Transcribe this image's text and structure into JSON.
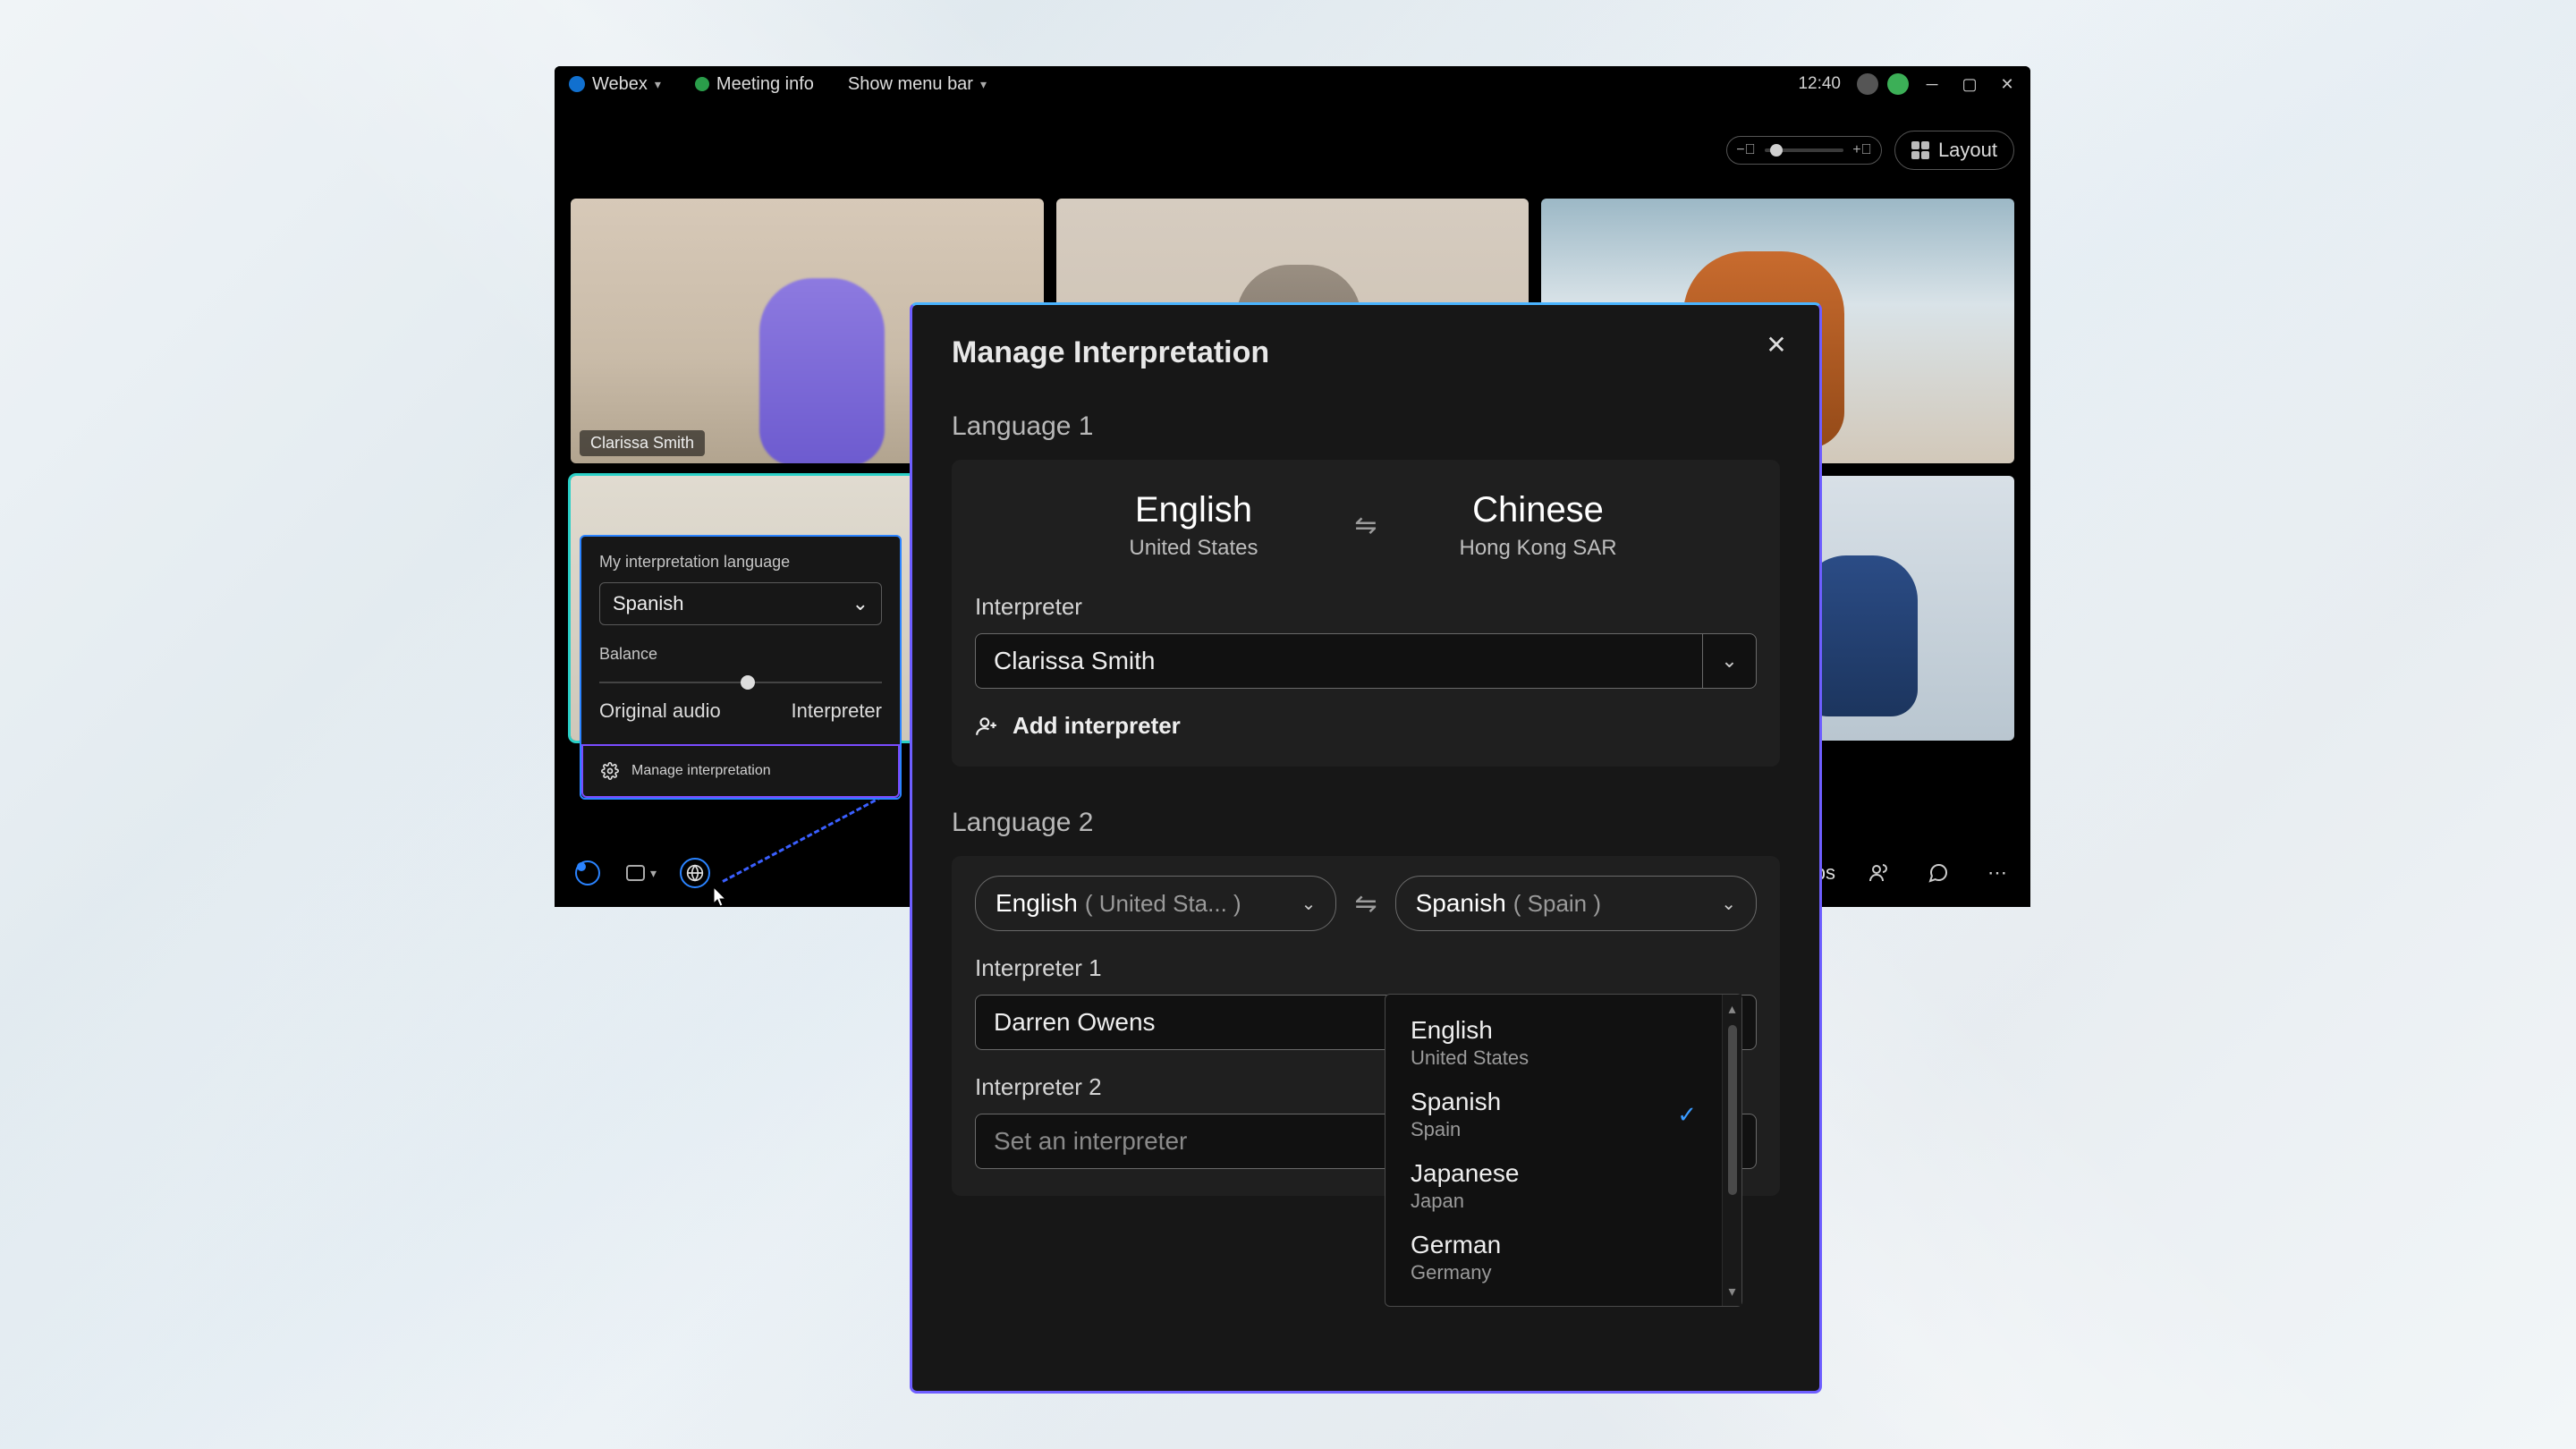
{
  "titlebar": {
    "appName": "Webex",
    "meetingInfo": "Meeting info",
    "showMenu": "Show menu bar",
    "clock": "12:40"
  },
  "toolbar": {
    "layout": "Layout"
  },
  "participants": {
    "tile1": "Clarissa Smith"
  },
  "bottomBar": {
    "apps": "Apps"
  },
  "interpPanel": {
    "myLangLabel": "My interpretation language",
    "selected": "Spanish",
    "balance": "Balance",
    "left": "Original audio",
    "right": "Interpreter",
    "manage": "Manage interpretation"
  },
  "modal": {
    "title": "Manage Interpretation",
    "lang1": {
      "section": "Language 1",
      "aName": "English",
      "aRegion": "United States",
      "bName": "Chinese",
      "bRegion": "Hong Kong SAR",
      "interpreterLabel": "Interpreter",
      "interpreterValue": "Clarissa Smith",
      "addInterpreter": "Add interpreter"
    },
    "lang2": {
      "section": "Language 2",
      "aName": "English",
      "aRegion": "( United Sta... )",
      "bName": "Spanish",
      "bRegion": "( Spain )",
      "interp1Label": "Interpreter 1",
      "interp1Value": "Darren Owens",
      "interp2Label": "Interpreter 2",
      "interp2Placeholder": "Set an interpreter"
    },
    "dropdown": {
      "items": [
        {
          "name": "English",
          "region": "United States",
          "selected": false
        },
        {
          "name": "Spanish",
          "region": "Spain",
          "selected": true
        },
        {
          "name": "Japanese",
          "region": "Japan",
          "selected": false
        },
        {
          "name": "German",
          "region": "Germany",
          "selected": false
        }
      ]
    }
  }
}
